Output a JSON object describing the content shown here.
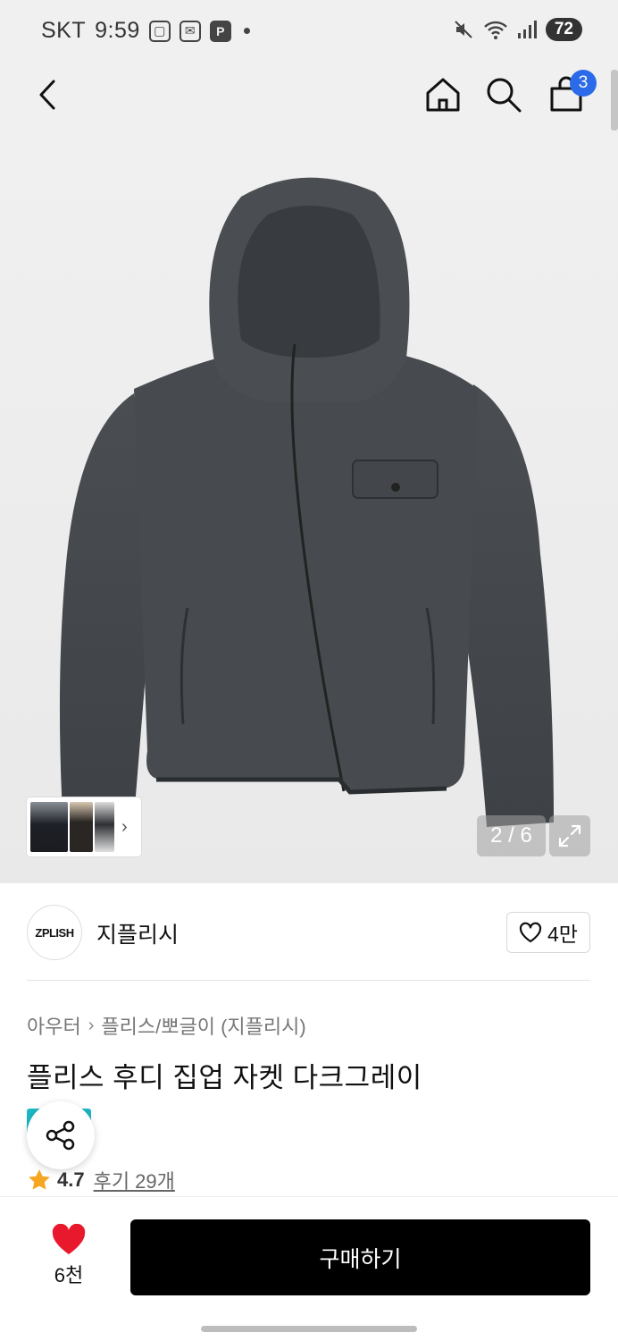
{
  "status_bar": {
    "carrier": "SKT",
    "time": "9:59",
    "battery": "72"
  },
  "header": {
    "cart_count": "3"
  },
  "gallery": {
    "page_indicator": "2 / 6",
    "thumb_chevron": "›"
  },
  "brand": {
    "logo_text": "ZPLISH",
    "name": "지플리시",
    "likes": "4만"
  },
  "product": {
    "breadcrumb": [
      "아우터",
      "플리스/뽀글이 (지플리시)"
    ],
    "breadcrumb_sep": "›",
    "title": "플리스 후디 집업 자켓 다크그레이",
    "rating": "4.7",
    "reviews": "후기 29개"
  },
  "bottom_bar": {
    "wish_count": "6천",
    "buy_label": "구매하기"
  },
  "colors": {
    "accent": "#2b6ae8",
    "heart": "#e8192c",
    "star": "#f5a623",
    "promo": "#1cb8c4"
  }
}
